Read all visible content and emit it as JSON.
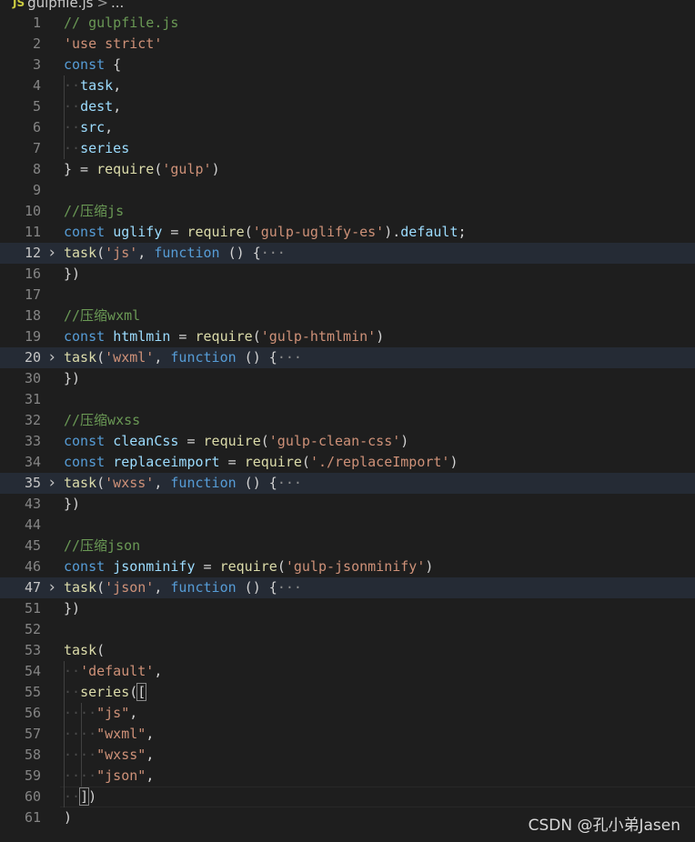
{
  "breadcrumb": {
    "icon": "JS",
    "file": "gulpfile.js",
    "separator": ">",
    "more": "..."
  },
  "lines": [
    {
      "num": "1",
      "indent": 0,
      "tokens": [
        [
          "cmt",
          "// gulpfile.js"
        ]
      ]
    },
    {
      "num": "2",
      "indent": 0,
      "tokens": [
        [
          "str",
          "'use strict'"
        ]
      ]
    },
    {
      "num": "3",
      "indent": 0,
      "tokens": [
        [
          "kw",
          "const"
        ],
        [
          "def",
          " {"
        ]
      ]
    },
    {
      "num": "4",
      "indent": 1,
      "tokens": [
        [
          "var",
          "task"
        ],
        [
          "def",
          ","
        ]
      ]
    },
    {
      "num": "5",
      "indent": 1,
      "tokens": [
        [
          "var",
          "dest"
        ],
        [
          "def",
          ","
        ]
      ]
    },
    {
      "num": "6",
      "indent": 1,
      "tokens": [
        [
          "var",
          "src"
        ],
        [
          "def",
          ","
        ]
      ]
    },
    {
      "num": "7",
      "indent": 1,
      "tokens": [
        [
          "var",
          "series"
        ]
      ]
    },
    {
      "num": "8",
      "indent": 0,
      "tokens": [
        [
          "def",
          "} = "
        ],
        [
          "fn",
          "require"
        ],
        [
          "def",
          "("
        ],
        [
          "str",
          "'gulp'"
        ],
        [
          "def",
          ")"
        ]
      ]
    },
    {
      "num": "9",
      "indent": 0,
      "tokens": []
    },
    {
      "num": "10",
      "indent": 0,
      "tokens": [
        [
          "cmt",
          "//压缩js"
        ]
      ]
    },
    {
      "num": "11",
      "indent": 0,
      "tokens": [
        [
          "kw",
          "const"
        ],
        [
          "def",
          " "
        ],
        [
          "var",
          "uglify"
        ],
        [
          "def",
          " = "
        ],
        [
          "fn",
          "require"
        ],
        [
          "def",
          "("
        ],
        [
          "str",
          "'gulp-uglify-es'"
        ],
        [
          "def",
          ")."
        ],
        [
          "var",
          "default"
        ],
        [
          "def",
          ";"
        ]
      ]
    },
    {
      "num": "12",
      "indent": 0,
      "folded": true,
      "tokens": [
        [
          "fn",
          "task"
        ],
        [
          "def",
          "("
        ],
        [
          "str",
          "'js'"
        ],
        [
          "def",
          ", "
        ],
        [
          "kw",
          "function"
        ],
        [
          "def",
          " () {"
        ],
        [
          "ell",
          "···"
        ]
      ]
    },
    {
      "num": "16",
      "indent": 0,
      "tokens": [
        [
          "def",
          "})"
        ]
      ]
    },
    {
      "num": "17",
      "indent": 0,
      "tokens": []
    },
    {
      "num": "18",
      "indent": 0,
      "tokens": [
        [
          "cmt",
          "//压缩wxml"
        ]
      ]
    },
    {
      "num": "19",
      "indent": 0,
      "tokens": [
        [
          "kw",
          "const"
        ],
        [
          "def",
          " "
        ],
        [
          "var",
          "htmlmin"
        ],
        [
          "def",
          " = "
        ],
        [
          "fn",
          "require"
        ],
        [
          "def",
          "("
        ],
        [
          "str",
          "'gulp-htmlmin'"
        ],
        [
          "def",
          ")"
        ]
      ]
    },
    {
      "num": "20",
      "indent": 0,
      "folded": true,
      "tokens": [
        [
          "fn",
          "task"
        ],
        [
          "def",
          "("
        ],
        [
          "str",
          "'wxml'"
        ],
        [
          "def",
          ", "
        ],
        [
          "kw",
          "function"
        ],
        [
          "def",
          " () {"
        ],
        [
          "ell",
          "···"
        ]
      ]
    },
    {
      "num": "30",
      "indent": 0,
      "tokens": [
        [
          "def",
          "})"
        ]
      ]
    },
    {
      "num": "31",
      "indent": 0,
      "tokens": []
    },
    {
      "num": "32",
      "indent": 0,
      "tokens": [
        [
          "cmt",
          "//压缩wxss"
        ]
      ]
    },
    {
      "num": "33",
      "indent": 0,
      "tokens": [
        [
          "kw",
          "const"
        ],
        [
          "def",
          " "
        ],
        [
          "var",
          "cleanCss"
        ],
        [
          "def",
          " = "
        ],
        [
          "fn",
          "require"
        ],
        [
          "def",
          "("
        ],
        [
          "str",
          "'gulp-clean-css'"
        ],
        [
          "def",
          ")"
        ]
      ]
    },
    {
      "num": "34",
      "indent": 0,
      "tokens": [
        [
          "kw",
          "const"
        ],
        [
          "def",
          " "
        ],
        [
          "var",
          "replaceimport"
        ],
        [
          "def",
          " = "
        ],
        [
          "fn",
          "require"
        ],
        [
          "def",
          "("
        ],
        [
          "str",
          "'./replaceImport'"
        ],
        [
          "def",
          ")"
        ]
      ]
    },
    {
      "num": "35",
      "indent": 0,
      "folded": true,
      "tokens": [
        [
          "fn",
          "task"
        ],
        [
          "def",
          "("
        ],
        [
          "str",
          "'wxss'"
        ],
        [
          "def",
          ", "
        ],
        [
          "kw",
          "function"
        ],
        [
          "def",
          " () {"
        ],
        [
          "ell",
          "···"
        ]
      ]
    },
    {
      "num": "43",
      "indent": 0,
      "tokens": [
        [
          "def",
          "})"
        ]
      ]
    },
    {
      "num": "44",
      "indent": 0,
      "tokens": []
    },
    {
      "num": "45",
      "indent": 0,
      "tokens": [
        [
          "cmt",
          "//压缩json"
        ]
      ]
    },
    {
      "num": "46",
      "indent": 0,
      "tokens": [
        [
          "kw",
          "const"
        ],
        [
          "def",
          " "
        ],
        [
          "var",
          "jsonminify"
        ],
        [
          "def",
          " = "
        ],
        [
          "fn",
          "require"
        ],
        [
          "def",
          "("
        ],
        [
          "str",
          "'gulp-jsonminify'"
        ],
        [
          "def",
          ")"
        ]
      ]
    },
    {
      "num": "47",
      "indent": 0,
      "folded": true,
      "tokens": [
        [
          "fn",
          "task"
        ],
        [
          "def",
          "("
        ],
        [
          "str",
          "'json'"
        ],
        [
          "def",
          ", "
        ],
        [
          "kw",
          "function"
        ],
        [
          "def",
          " () {"
        ],
        [
          "ell",
          "···"
        ]
      ]
    },
    {
      "num": "51",
      "indent": 0,
      "tokens": [
        [
          "def",
          "})"
        ]
      ]
    },
    {
      "num": "52",
      "indent": 0,
      "tokens": []
    },
    {
      "num": "53",
      "indent": 0,
      "tokens": [
        [
          "fn",
          "task"
        ],
        [
          "def",
          "("
        ]
      ]
    },
    {
      "num": "54",
      "indent": 1,
      "tokens": [
        [
          "str",
          "'default'"
        ],
        [
          "def",
          ","
        ]
      ]
    },
    {
      "num": "55",
      "indent": 1,
      "tokens": [
        [
          "fn",
          "series"
        ],
        [
          "def",
          "("
        ],
        [
          "hl",
          "["
        ]
      ]
    },
    {
      "num": "56",
      "indent": 2,
      "tokens": [
        [
          "str",
          "\"js\""
        ],
        [
          "def",
          ","
        ]
      ]
    },
    {
      "num": "57",
      "indent": 2,
      "tokens": [
        [
          "str",
          "\"wxml\""
        ],
        [
          "def",
          ","
        ]
      ]
    },
    {
      "num": "58",
      "indent": 2,
      "tokens": [
        [
          "str",
          "\"wxss\""
        ],
        [
          "def",
          ","
        ]
      ]
    },
    {
      "num": "59",
      "indent": 2,
      "tokens": [
        [
          "str",
          "\"json\""
        ],
        [
          "def",
          ","
        ]
      ]
    },
    {
      "num": "60",
      "indent": 1,
      "current": true,
      "tokens": [
        [
          "hl",
          "]"
        ],
        [
          "def",
          ")"
        ]
      ]
    },
    {
      "num": "61",
      "indent": 0,
      "tokens": [
        [
          "def",
          ")"
        ]
      ]
    }
  ],
  "fold_glyph": "›",
  "watermark": "CSDN @孔小弟Jasen"
}
